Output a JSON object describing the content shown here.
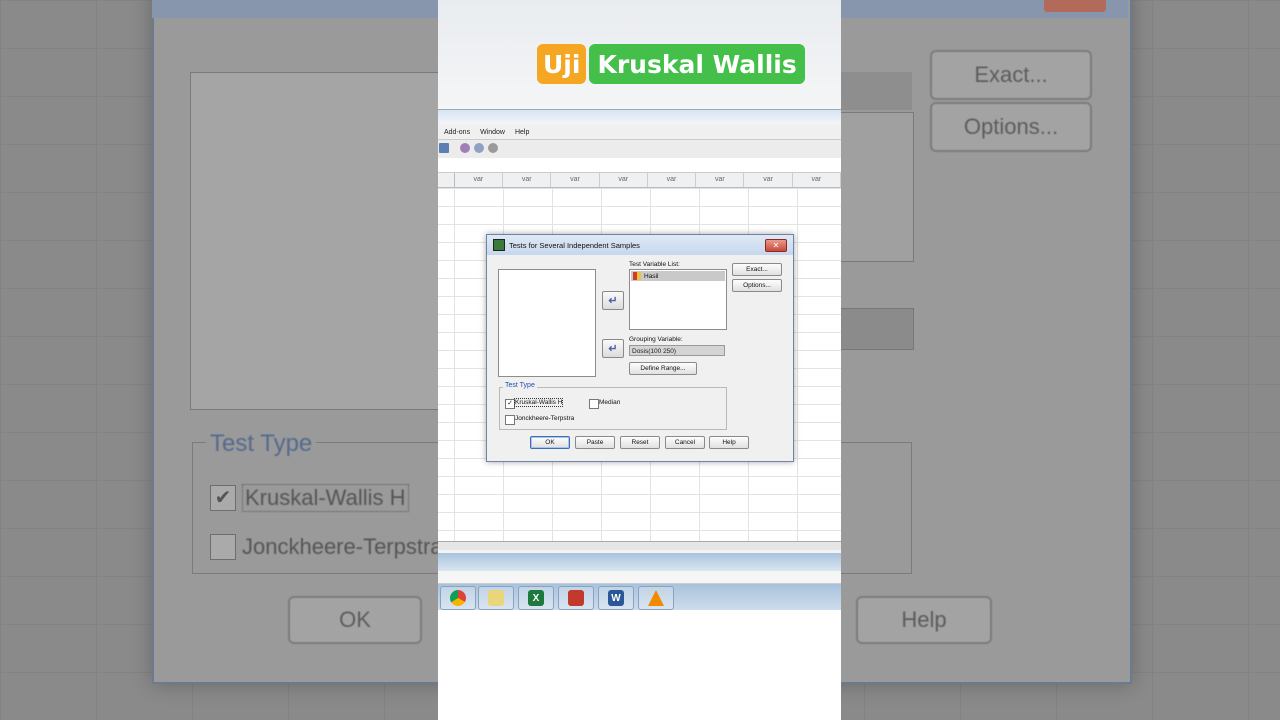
{
  "overlay_title": {
    "part1": "Uji",
    "part2": "Kruskal Wallis"
  },
  "menu": [
    "Add-ons",
    "Window",
    "Help"
  ],
  "grid": {
    "column_header": "var",
    "columns": [
      "var",
      "var",
      "var",
      "var",
      "var",
      "var",
      "var",
      "var"
    ]
  },
  "dialog": {
    "title": "Tests for Several Independent Samples",
    "test_variable_list_label": "Test Variable List:",
    "test_variables": [
      "Hasil"
    ],
    "grouping_variable_label": "Grouping Variable:",
    "grouping_variable_value": "Dosis(100 250)",
    "define_range_label": "Define Range...",
    "exact_label": "Exact...",
    "options_label": "Options...",
    "test_type": {
      "label": "Test Type",
      "kruskal": {
        "label": "Kruskal-Wallis H",
        "checked": true
      },
      "median": {
        "label": "Median",
        "checked": false
      },
      "jonckheere": {
        "label": "Jonckheere-Terpstra",
        "checked": false
      }
    },
    "buttons": {
      "ok": "OK",
      "paste": "Paste",
      "reset": "Reset",
      "cancel": "Cancel",
      "help": "Help"
    }
  },
  "background": {
    "exact": "Exact...",
    "options": "Options...",
    "test_type": "Test Type",
    "kruskal": "Kruskal-Wallis H",
    "jonckheere": "Jonckheere-Terpstra",
    "ok": "OK",
    "help": "Help"
  },
  "taskbar": [
    "chrome-icon",
    "explorer-icon",
    "excel-icon",
    "spss-icon",
    "word-icon",
    "vlc-icon"
  ],
  "colors": {
    "accent_orange": "#f5a623",
    "accent_green": "#44c04a",
    "dialog_blue_label": "#1f4fa8"
  }
}
